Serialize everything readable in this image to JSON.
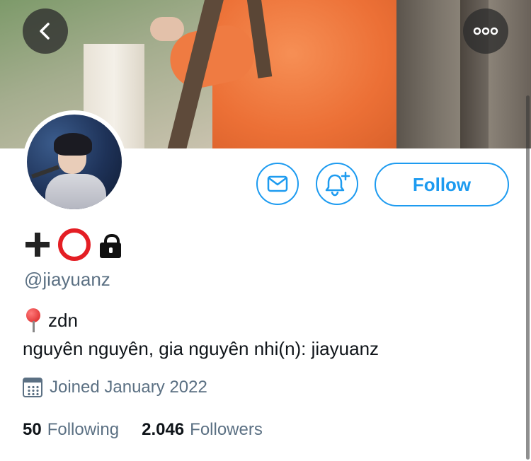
{
  "profile": {
    "handle": "@jiayuanz",
    "location": "zdn",
    "bio": "nguyên nguyên, gia nguyên nhi(n): jiayuanz",
    "joined": "Joined January 2022",
    "following_count": "50",
    "following_label": "Following",
    "followers_count": "2.046",
    "followers_label": "Followers",
    "name_icons": [
      "plus-icon",
      "red-ring-icon"
    ],
    "protected_icon": "lock-icon"
  },
  "actions": {
    "follow_label": "Follow",
    "message_icon": "mail-icon",
    "notify_icon": "bell-plus-icon"
  },
  "nav": {
    "back_icon": "chevron-left-icon",
    "more_icon": "more-icon"
  },
  "colors": {
    "accent": "#1d9bf0",
    "secondary_text": "#5b7083",
    "primary_text": "#0f1419",
    "ring_red": "#e41e24"
  }
}
